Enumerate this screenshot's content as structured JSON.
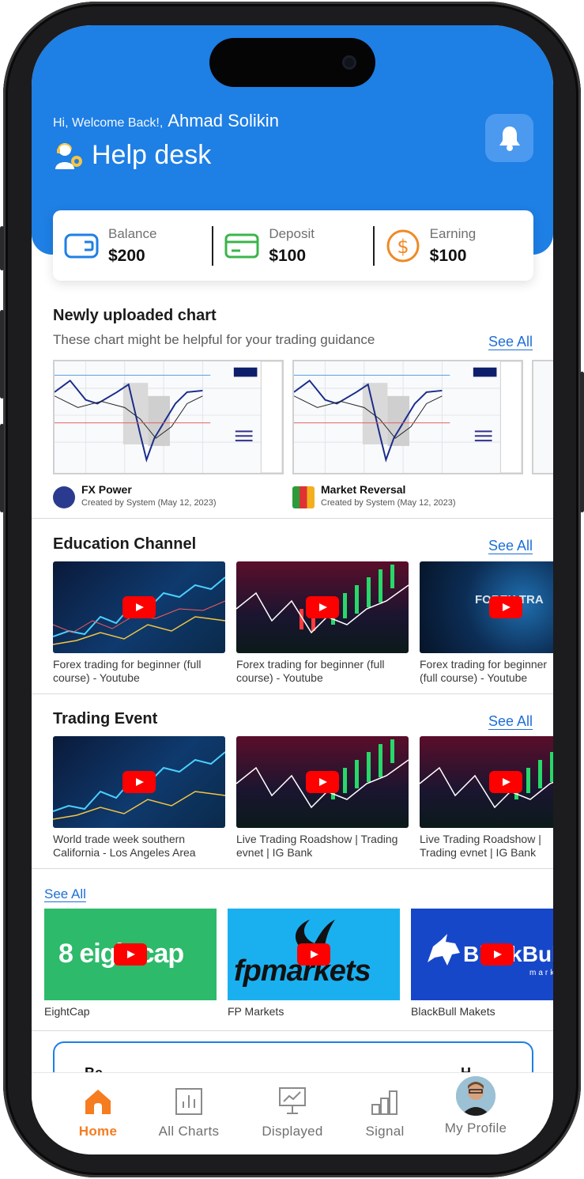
{
  "header": {
    "greeting": "Hi, Welcome Back!,",
    "user_name": "Ahmad Solikin",
    "title": "Help desk"
  },
  "stats": [
    {
      "label": "Balance",
      "value": "$200",
      "icon": "wallet-icon",
      "color": "#1e7fe5"
    },
    {
      "label": "Deposit",
      "value": "$100",
      "icon": "card-icon",
      "color": "#3cb44b"
    },
    {
      "label": "Earning",
      "value": "$100",
      "icon": "dollar-coin-icon",
      "color": "#f08a24"
    }
  ],
  "charts_section": {
    "title": "Newly uploaded chart",
    "subtitle": "These chart might be helpful for your trading guidance",
    "see_all": "See All",
    "items": [
      {
        "name": "FX Power",
        "by": "Created by System (May 12,  2023)"
      },
      {
        "name": "Market Reversal",
        "by": "Created by System (May 12,  2023)"
      }
    ]
  },
  "education_section": {
    "title": "Education Channel",
    "see_all": "See All",
    "items": [
      {
        "caption": "Forex trading for beginner (full course) - Youtube"
      },
      {
        "caption": "Forex trading for beginner (full course) - Youtube"
      },
      {
        "caption": "Forex trading for beginner (full course) - Youtube",
        "overlay": "FOREX TRA"
      }
    ]
  },
  "event_section": {
    "title": "Trading Event",
    "see_all": "See All",
    "items": [
      {
        "caption": "World trade week southern California - Los Angeles Area"
      },
      {
        "caption": "Live Trading Roadshow | Trading evnet | IG Bank"
      },
      {
        "caption": "Live Trading Roadshow | Trading evnet | IG Bank"
      }
    ]
  },
  "broker_section": {
    "see_all": "See All",
    "items": [
      {
        "caption": "EightCap",
        "logo": "8 eightcap",
        "bg": "#2dba6a"
      },
      {
        "caption": "FP Markets",
        "logo": "fpmarkets",
        "bg": "#1ab0f0"
      },
      {
        "caption": "BlackBull Makets",
        "logo": "BlackBull",
        "sub": "markets",
        "bg": "#1747c9"
      }
    ]
  },
  "promo": {
    "left": "Be",
    "right": "H"
  },
  "tabbar": {
    "tabs": [
      {
        "label": "Home",
        "icon": "home-icon",
        "active": true
      },
      {
        "label": "All Charts",
        "icon": "bar-chart-icon"
      },
      {
        "label": "Displayed",
        "icon": "presentation-icon"
      },
      {
        "label": "Signal",
        "icon": "signal-bars-icon"
      },
      {
        "label": "My Profile",
        "icon": "avatar"
      }
    ]
  },
  "colors": {
    "primary": "#1e7fe5",
    "accent": "#f57c1f"
  }
}
